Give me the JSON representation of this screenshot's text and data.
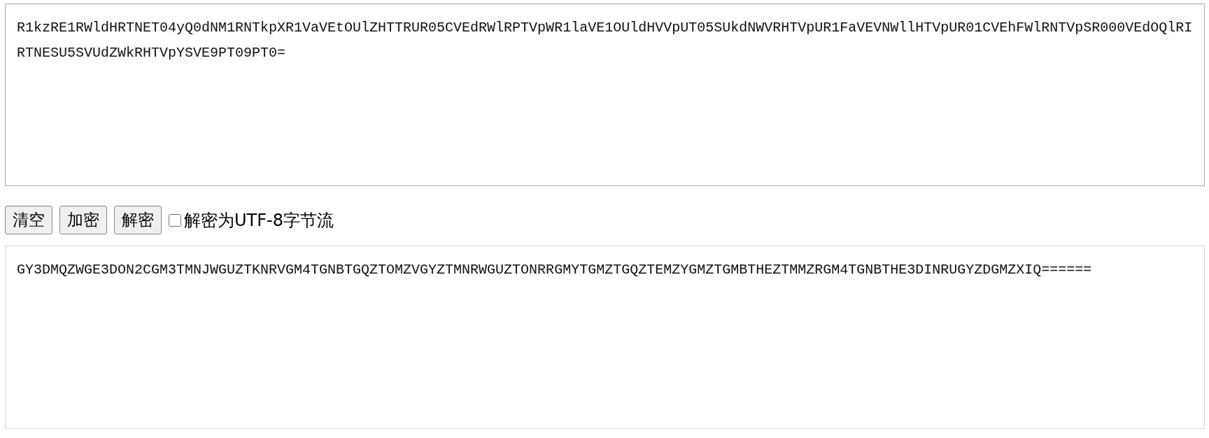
{
  "input_text": "R1kzRE1RWldHRTNET04yQ0dNM1RNTkpXR1VaVEtOUlZHTTRUR05CVEdRWlRPTVpWR1laVE1OUldHVVpUT05SUkdNWVRHTVpUR1FaVEVNWllHTVpUR01CVEhFWlRNTVpSR000VEdOQlRIRTNESU5SVUdZWkRHTVpYSVE9PT09PT0=",
  "buttons": [
    {
      "label": "清空"
    },
    {
      "label": "加密"
    },
    {
      "label": "解密"
    }
  ],
  "checkbox": {
    "label": "解密为UTF-8字节流",
    "checked": false
  },
  "output_text": "GY3DMQZWGE3DON2CGM3TMNJWGUZTKNRVGM4TGNBTGQZTOMZVGYZTMNRWGUZTONRRGMYTGMZTGQZTEMZYGMZTGMBTHEZTMMZRGM4TGNBTHE3DINRUGYZDGMZXIQ======"
}
